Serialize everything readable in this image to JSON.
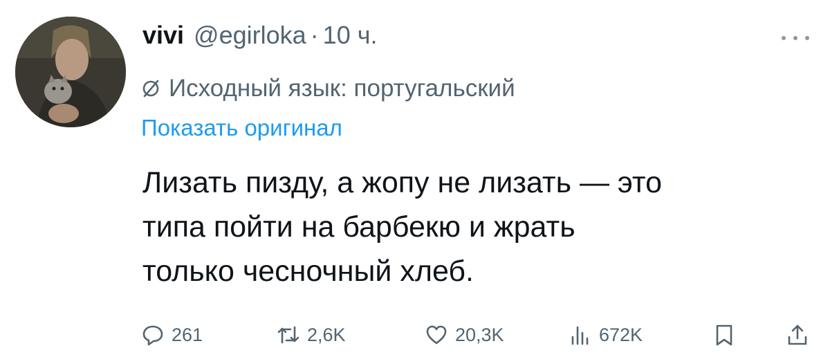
{
  "tweet": {
    "author_name": "vivi",
    "author_handle": "@egirloka",
    "separator": "·",
    "time": "10 ч.",
    "translation_notice": "Исходный язык: португальский",
    "show_original": "Показать оригинал",
    "text_lines": [
      "Лизать пизду, а жопу не лизать — это",
      "типа пойти на барбекю и жрать",
      "только чесночный хлеб."
    ],
    "actions": {
      "replies": "261",
      "retweets": "2,6K",
      "likes": "20,3K",
      "views": "672K"
    }
  },
  "icons": {
    "more": "more-dots-icon",
    "translate": "translate-icon",
    "reply": "reply-icon",
    "retweet": "retweet-icon",
    "like": "heart-icon",
    "views": "views-icon",
    "bookmark": "bookmark-icon",
    "share": "share-icon"
  },
  "colors": {
    "text": "#0f1419",
    "secondary": "#536471",
    "link": "#1d9bf0"
  }
}
